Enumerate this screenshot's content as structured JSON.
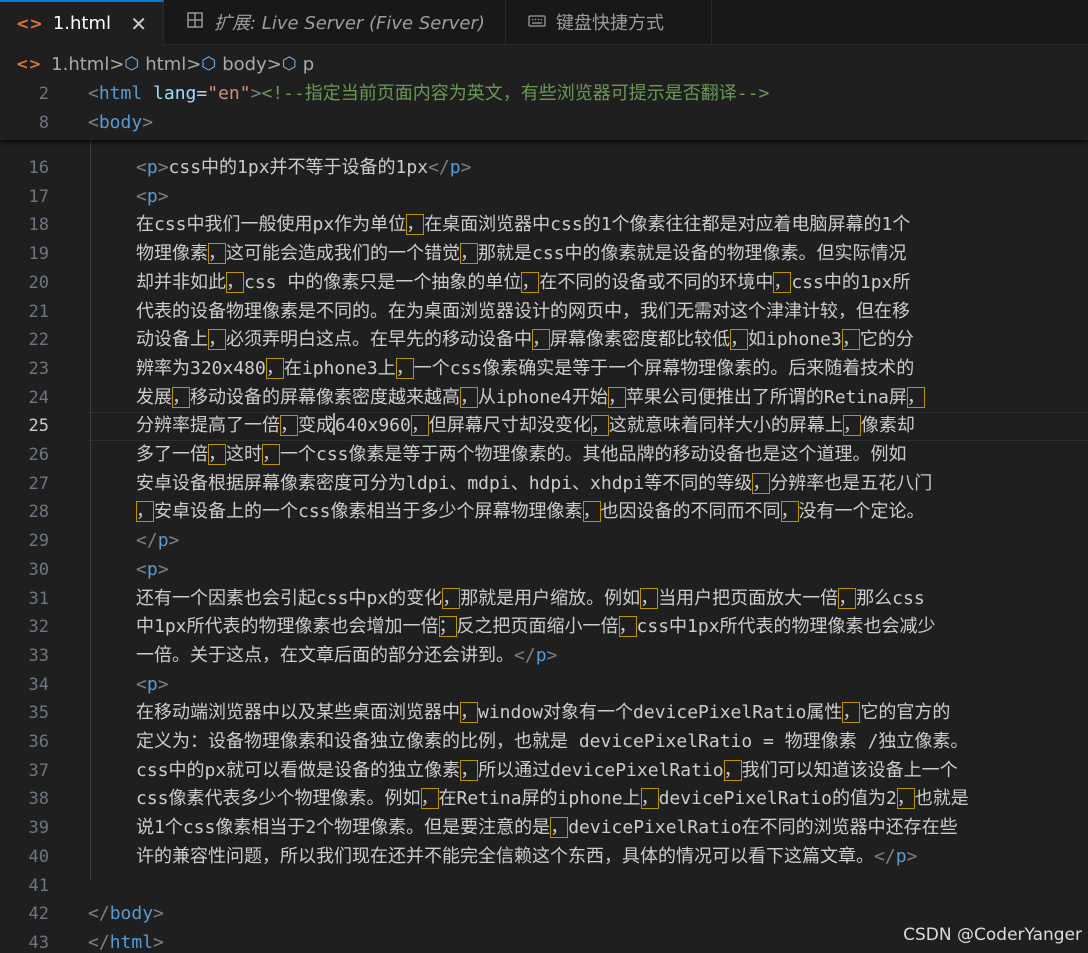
{
  "tabs": [
    {
      "label": "1.html",
      "icon": "html-file-icon",
      "active": true,
      "close": "✕"
    },
    {
      "label": "扩展: Live Server (Five Server)",
      "icon": "extension-preview-icon"
    },
    {
      "label": "键盘快捷方式",
      "icon": "keyboard-icon"
    }
  ],
  "breadcrumb": [
    "1.html",
    "html",
    "body",
    "p"
  ],
  "sticky": [
    {
      "num": "2",
      "parts": [
        [
          "br",
          "<"
        ],
        [
          "tag",
          "html"
        ],
        [
          "plain",
          " "
        ],
        [
          "attr",
          "lang"
        ],
        [
          "plain",
          "="
        ],
        [
          "str",
          "\"en\""
        ],
        [
          "br",
          ">"
        ],
        [
          "cmt",
          "<!--指定当前页面内容为英文，有些浏览器可提示是否翻译-->"
        ]
      ]
    },
    {
      "num": "8",
      "parts": [
        [
          "br",
          "<"
        ],
        [
          "tag",
          "body"
        ],
        [
          "br",
          ">"
        ]
      ]
    }
  ],
  "lines": [
    {
      "num": "16",
      "ind": true,
      "parts": [
        [
          "br",
          "<"
        ],
        [
          "tag",
          "p"
        ],
        [
          "br",
          ">"
        ],
        [
          "plain",
          "css中的1px并不等于设备的1px"
        ],
        [
          "br",
          "</"
        ],
        [
          "tag",
          "p"
        ],
        [
          "br",
          ">"
        ]
      ]
    },
    {
      "num": "17",
      "ind": true,
      "parts": [
        [
          "br",
          "<"
        ],
        [
          "tag",
          "p"
        ],
        [
          "br",
          ">"
        ]
      ]
    },
    {
      "num": "18",
      "ind": true,
      "parts": [
        [
          "plain",
          "在css中我们一般使用px作为单位"
        ],
        [
          "mk",
          "，"
        ],
        [
          "plain",
          "在桌面浏览器中css的1个像素往往都是对应着电脑屏幕的1个"
        ]
      ]
    },
    {
      "num": "19",
      "ind": true,
      "parts": [
        [
          "plain",
          "物理像素"
        ],
        [
          "mk",
          "，"
        ],
        [
          "plain",
          "这可能会造成我们的一个错觉"
        ],
        [
          "mk",
          "，"
        ],
        [
          "plain",
          "那就是css中的像素就是设备的物理像素。但实际情况"
        ]
      ]
    },
    {
      "num": "20",
      "ind": true,
      "parts": [
        [
          "plain",
          "却并非如此"
        ],
        [
          "mk",
          "，"
        ],
        [
          "plain",
          "css 中的像素只是一个抽象的单位"
        ],
        [
          "mk",
          "，"
        ],
        [
          "plain",
          "在不同的设备或不同的环境中"
        ],
        [
          "mk",
          "，"
        ],
        [
          "plain",
          "css中的1px所"
        ]
      ]
    },
    {
      "num": "21",
      "ind": true,
      "parts": [
        [
          "plain",
          "代表的设备物理像素是不同的。在为桌面浏览器设计的网页中，我们无需对这个津津计较，但在移"
        ]
      ]
    },
    {
      "num": "22",
      "ind": true,
      "parts": [
        [
          "plain",
          "动设备上"
        ],
        [
          "mk",
          "，"
        ],
        [
          "plain",
          "必须弄明白这点。在早先的移动设备中"
        ],
        [
          "mk",
          "，"
        ],
        [
          "plain",
          "屏幕像素密度都比较低"
        ],
        [
          "mk",
          "，"
        ],
        [
          "plain",
          "如iphone3"
        ],
        [
          "mk",
          "，"
        ],
        [
          "plain",
          "它的分"
        ]
      ]
    },
    {
      "num": "23",
      "ind": true,
      "parts": [
        [
          "plain",
          "辨率为320x480"
        ],
        [
          "mk",
          "，"
        ],
        [
          "plain",
          "在iphone3上"
        ],
        [
          "mk",
          "，"
        ],
        [
          "plain",
          "一个css像素确实是等于一个屏幕物理像素的。后来随着技术的"
        ]
      ]
    },
    {
      "num": "24",
      "ind": true,
      "parts": [
        [
          "plain",
          "发展"
        ],
        [
          "mk",
          "，"
        ],
        [
          "plain",
          "移动设备的屏幕像素密度越来越高"
        ],
        [
          "mk",
          "，"
        ],
        [
          "plain",
          "从iphone4开始"
        ],
        [
          "mk",
          "，"
        ],
        [
          "plain",
          "苹果公司便推出了所谓的Retina屏"
        ],
        [
          "mk",
          "，"
        ]
      ]
    },
    {
      "num": "25",
      "ind": true,
      "current": true,
      "parts": [
        [
          "plain",
          "分辨率提高了一倍"
        ],
        [
          "mk",
          "，"
        ],
        [
          "plain",
          "变成"
        ],
        [
          "cursor",
          ""
        ],
        [
          "plain",
          "640x960"
        ],
        [
          "mk",
          "，"
        ],
        [
          "plain",
          "但屏幕尺寸却没变化"
        ],
        [
          "mk",
          "，"
        ],
        [
          "plain",
          "这就意味着同样大小的屏幕上"
        ],
        [
          "mk",
          "，"
        ],
        [
          "plain",
          "像素却"
        ]
      ]
    },
    {
      "num": "26",
      "ind": true,
      "parts": [
        [
          "plain",
          "多了一倍"
        ],
        [
          "mk",
          "，"
        ],
        [
          "plain",
          "这时"
        ],
        [
          "mk",
          "，"
        ],
        [
          "plain",
          "一个css像素是等于两个物理像素的。其他品牌的移动设备也是这个道理。例如"
        ]
      ]
    },
    {
      "num": "27",
      "ind": true,
      "parts": [
        [
          "plain",
          "安卓设备根据屏幕像素密度可分为ldpi、mdpi、hdpi、xhdpi等不同的等级"
        ],
        [
          "mk",
          "，"
        ],
        [
          "plain",
          "分辨率也是五花八门"
        ]
      ]
    },
    {
      "num": "28",
      "ind": true,
      "parts": [
        [
          "mk",
          "，"
        ],
        [
          "plain",
          "安卓设备上的一个css像素相当于多少个屏幕物理像素"
        ],
        [
          "mk",
          "，"
        ],
        [
          "plain",
          "也因设备的不同而不同"
        ],
        [
          "mk",
          "，"
        ],
        [
          "plain",
          "没有一个定论。"
        ]
      ]
    },
    {
      "num": "29",
      "ind": true,
      "parts": [
        [
          "br",
          "</"
        ],
        [
          "tag",
          "p"
        ],
        [
          "br",
          ">"
        ]
      ]
    },
    {
      "num": "30",
      "ind": true,
      "parts": [
        [
          "br",
          "<"
        ],
        [
          "tag",
          "p"
        ],
        [
          "br",
          ">"
        ]
      ]
    },
    {
      "num": "31",
      "ind": true,
      "parts": [
        [
          "plain",
          "还有一个因素也会引起css中px的变化"
        ],
        [
          "mk",
          "，"
        ],
        [
          "plain",
          "那就是用户缩放。例如"
        ],
        [
          "mk",
          "，"
        ],
        [
          "plain",
          "当用户把页面放大一倍"
        ],
        [
          "mk",
          "，"
        ],
        [
          "plain",
          "那么css"
        ]
      ]
    },
    {
      "num": "32",
      "ind": true,
      "parts": [
        [
          "plain",
          "中1px所代表的物理像素也会增加一倍"
        ],
        [
          "mk",
          "；"
        ],
        [
          "plain",
          "反之把页面缩小一倍"
        ],
        [
          "mk",
          "，"
        ],
        [
          "plain",
          "css中1px所代表的物理像素也会减少"
        ]
      ]
    },
    {
      "num": "33",
      "ind": true,
      "parts": [
        [
          "plain",
          "一倍。关于这点，在文章后面的部分还会讲到。"
        ],
        [
          "br",
          "</"
        ],
        [
          "tag",
          "p"
        ],
        [
          "br",
          ">"
        ]
      ]
    },
    {
      "num": "34",
      "ind": true,
      "parts": [
        [
          "br",
          "<"
        ],
        [
          "tag",
          "p"
        ],
        [
          "br",
          ">"
        ]
      ]
    },
    {
      "num": "35",
      "ind": true,
      "parts": [
        [
          "plain",
          "在移动端浏览器中以及某些桌面浏览器中"
        ],
        [
          "mk",
          "，"
        ],
        [
          "plain",
          "window对象有一个devicePixelRatio属性"
        ],
        [
          "mk",
          "，"
        ],
        [
          "plain",
          "它的官方的"
        ]
      ]
    },
    {
      "num": "36",
      "ind": true,
      "parts": [
        [
          "plain",
          "定义为：设备物理像素和设备独立像素的比例，也就是 devicePixelRatio = 物理像素 /独立像素。"
        ]
      ]
    },
    {
      "num": "37",
      "ind": true,
      "parts": [
        [
          "plain",
          "css中的px就可以看做是设备的独立像素"
        ],
        [
          "mk",
          "，"
        ],
        [
          "plain",
          "所以通过devicePixelRatio"
        ],
        [
          "mk",
          "，"
        ],
        [
          "plain",
          "我们可以知道该设备上一个"
        ]
      ]
    },
    {
      "num": "38",
      "ind": true,
      "parts": [
        [
          "plain",
          "css像素代表多少个物理像素。例如"
        ],
        [
          "mk",
          "，"
        ],
        [
          "plain",
          "在Retina屏的iphone上"
        ],
        [
          "mk",
          "，"
        ],
        [
          "plain",
          "devicePixelRatio的值为2"
        ],
        [
          "mk",
          "，"
        ],
        [
          "plain",
          "也就是"
        ]
      ]
    },
    {
      "num": "39",
      "ind": true,
      "parts": [
        [
          "plain",
          "说1个css像素相当于2个物理像素。但是要注意的是"
        ],
        [
          "mk",
          "，"
        ],
        [
          "plain",
          "devicePixelRatio在不同的浏览器中还存在些"
        ]
      ]
    },
    {
      "num": "40",
      "ind": true,
      "parts": [
        [
          "plain",
          "许的兼容性问题，所以我们现在还并不能完全信赖这个东西，具体的情况可以看下这篇文章。"
        ],
        [
          "br",
          "</"
        ],
        [
          "tag",
          "p"
        ],
        [
          "br",
          ">"
        ]
      ]
    },
    {
      "num": "41",
      "ind": true,
      "parts": []
    },
    {
      "num": "42",
      "ind": false,
      "parts": [
        [
          "br",
          "</"
        ],
        [
          "tag",
          "body"
        ],
        [
          "br",
          ">"
        ]
      ]
    },
    {
      "num": "43",
      "ind": false,
      "parts": [
        [
          "br",
          "</"
        ],
        [
          "tag",
          "html"
        ],
        [
          "br",
          ">"
        ]
      ]
    }
  ],
  "watermark": "CSDN @CoderYanger",
  "colors": {
    "background": "#1f1f1f",
    "tag": "#569cd6",
    "attr": "#9cdcfe",
    "string": "#ce9178",
    "comment": "#6a9955",
    "accent": "#0078d4",
    "marker": "#b89500"
  }
}
